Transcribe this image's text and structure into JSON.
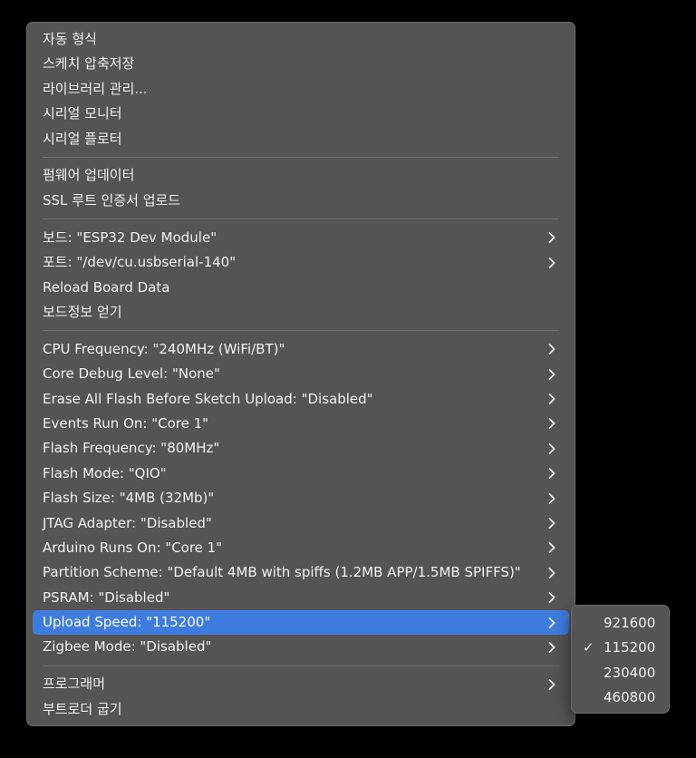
{
  "menu": {
    "groups": [
      [
        {
          "label": "자동 형식",
          "submenu": false
        },
        {
          "label": "스케치 압축저장",
          "submenu": false
        },
        {
          "label": "라이브러리 관리...",
          "submenu": false
        },
        {
          "label": "시리얼 모니터",
          "submenu": false
        },
        {
          "label": "시리얼 플로터",
          "submenu": false
        }
      ],
      [
        {
          "label": "펌웨어 업데이터",
          "submenu": false
        },
        {
          "label": "SSL 루트 인증서 업로드",
          "submenu": false
        }
      ],
      [
        {
          "label": "보드: \"ESP32 Dev Module\"",
          "submenu": true
        },
        {
          "label": "포트: \"/dev/cu.usbserial-140\"",
          "submenu": true
        },
        {
          "label": "Reload Board Data",
          "submenu": false
        },
        {
          "label": "보드정보 얻기",
          "submenu": false
        }
      ],
      [
        {
          "label": "CPU Frequency: \"240MHz (WiFi/BT)\"",
          "submenu": true
        },
        {
          "label": "Core Debug Level: \"None\"",
          "submenu": true
        },
        {
          "label": "Erase All Flash Before Sketch Upload: \"Disabled\"",
          "submenu": true
        },
        {
          "label": "Events Run On: \"Core 1\"",
          "submenu": true
        },
        {
          "label": "Flash Frequency: \"80MHz\"",
          "submenu": true
        },
        {
          "label": "Flash Mode: \"QIO\"",
          "submenu": true
        },
        {
          "label": "Flash Size: \"4MB (32Mb)\"",
          "submenu": true
        },
        {
          "label": "JTAG Adapter: \"Disabled\"",
          "submenu": true
        },
        {
          "label": "Arduino Runs On: \"Core 1\"",
          "submenu": true
        },
        {
          "label": "Partition Scheme: \"Default 4MB with spiffs (1.2MB APP/1.5MB SPIFFS)\"",
          "submenu": true
        },
        {
          "label": "PSRAM: \"Disabled\"",
          "submenu": true
        },
        {
          "label": "Upload Speed: \"115200\"",
          "submenu": true,
          "active": true
        },
        {
          "label": "Zigbee Mode: \"Disabled\"",
          "submenu": true
        }
      ],
      [
        {
          "label": "프로그래머",
          "submenu": true
        },
        {
          "label": "부트로더 굽기",
          "submenu": false
        }
      ]
    ]
  },
  "upload_speed_submenu": {
    "check_mark": "✓",
    "options": [
      {
        "label": "921600",
        "selected": false
      },
      {
        "label": "115200",
        "selected": true
      },
      {
        "label": "230400",
        "selected": false
      },
      {
        "label": "460800",
        "selected": false
      }
    ]
  },
  "colors": {
    "menu_background": "#555453",
    "highlight": "#3f7ce0",
    "text": "#f2f2f2",
    "separator": "#6e6d6c"
  }
}
